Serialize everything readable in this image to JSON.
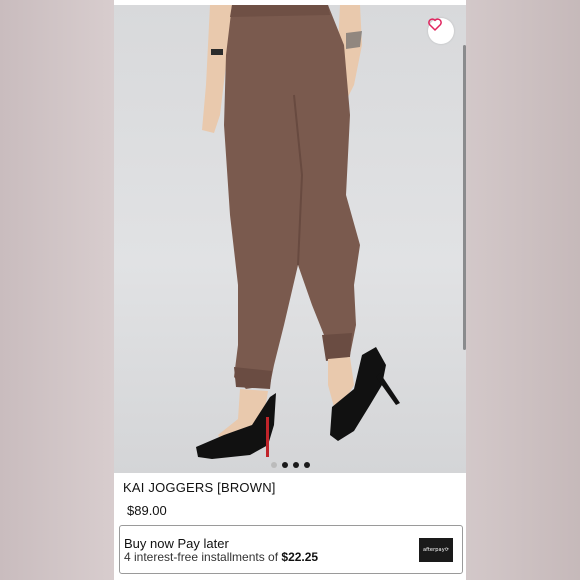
{
  "product": {
    "name": "KAI JOGGERS [BROWN]",
    "price": "$89.00"
  },
  "gallery": {
    "image_name": "product-photo",
    "dots": [
      {
        "active": false
      },
      {
        "active": true
      },
      {
        "active": true
      },
      {
        "active": true
      }
    ],
    "favorite_icon": "heart-icon"
  },
  "afterpay": {
    "headline": "Buy now Pay later",
    "installments_prefix": "4 interest-free installments of ",
    "installments_amount": "$22.25",
    "logo_text": "afterpay⟳"
  },
  "colors": {
    "heart": "#e0245e",
    "pants": "#7a5a4e",
    "shoes": "#111111",
    "sole": "#c0242a"
  }
}
